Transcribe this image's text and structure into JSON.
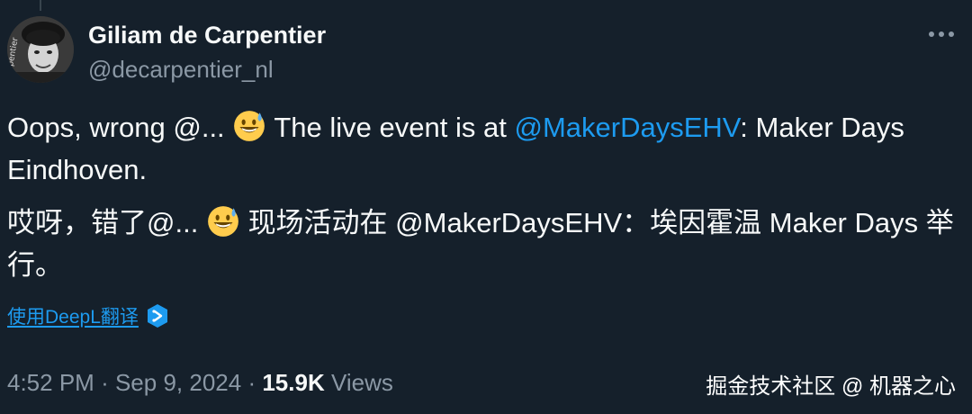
{
  "author": {
    "name": "Giliam de Carpentier",
    "handle": "@decarpentier_nl"
  },
  "tweet": {
    "para1": {
      "prefix": "Oops, wrong @...",
      "middle": "The live event is at",
      "mention": "@MakerDaysEHV",
      "suffix": ": Maker Days Eindhoven."
    },
    "para2": {
      "prefix": "哎呀，错了@...",
      "suffix": "现场活动在 @MakerDaysEHV：埃因霍温 Maker Days 举行。"
    }
  },
  "translate": {
    "label": "使用DeepL翻译"
  },
  "meta": {
    "time": "4:52 PM",
    "separator": "·",
    "date": "Sep 9, 2024",
    "views_count": "15.9K",
    "views_label": "Views"
  },
  "watermark": "掘金技术社区 @ 机器之心",
  "icons": {
    "more": "more-icon",
    "emoji": "grinning-face-with-sweat-emoji",
    "deepl": "deepl-icon"
  },
  "colors": {
    "background": "#15202b",
    "text": "#f7f9f9",
    "secondary": "#8b98a5",
    "accent": "#1d9bf0"
  }
}
